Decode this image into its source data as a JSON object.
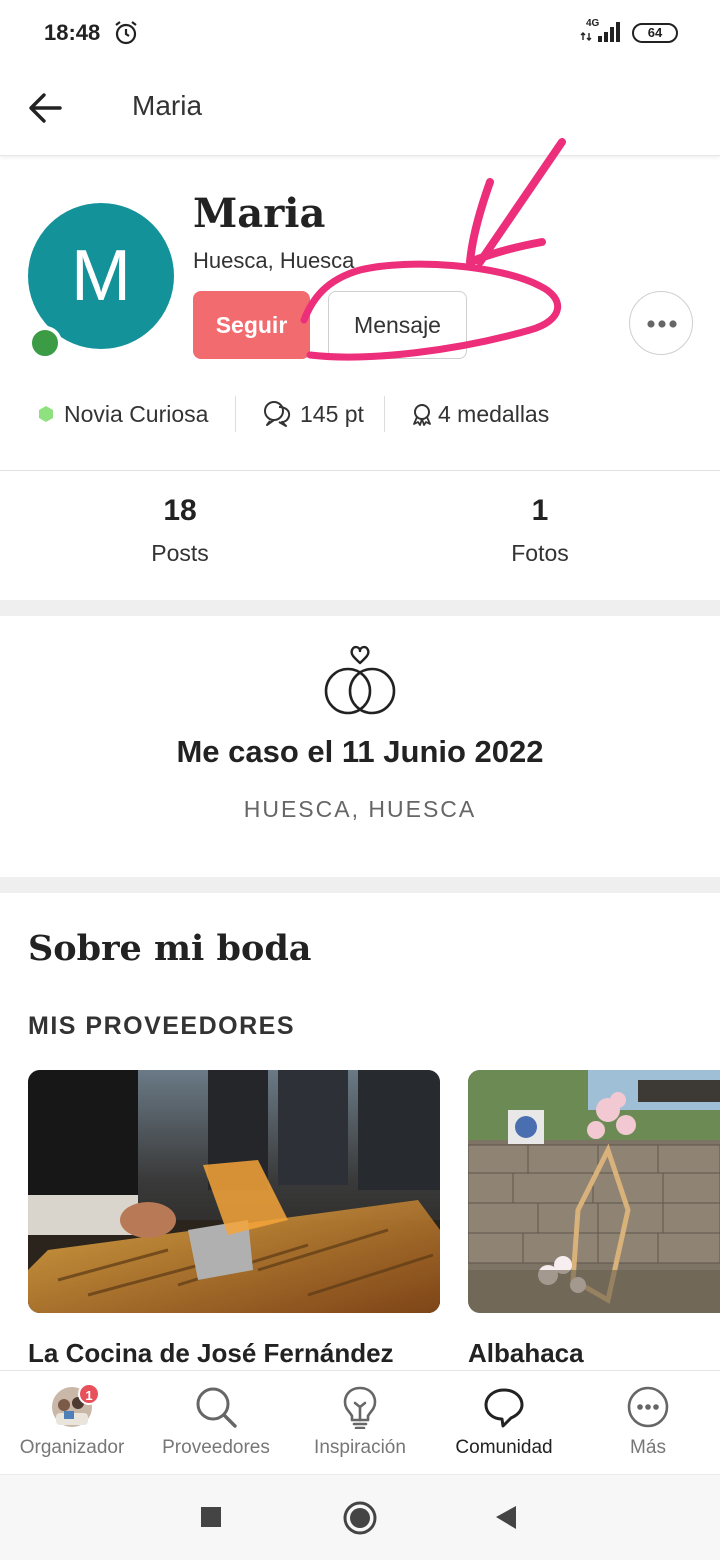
{
  "status_bar": {
    "time": "18:48",
    "network": "4G",
    "battery": "64"
  },
  "app_bar": {
    "title": "Maria"
  },
  "profile": {
    "avatar_letter": "M",
    "name": "Maria",
    "location": "Huesca, Huesca",
    "follow_label": "Seguir",
    "message_label": "Mensaje",
    "accent": "#f26b6f",
    "avatar_color": "#14929a"
  },
  "stats": {
    "level": "Novia Curiosa",
    "points": "145 pt",
    "medals": "4 medallas"
  },
  "counts": [
    {
      "value": "18",
      "label": "Posts"
    },
    {
      "value": "1",
      "label": "Fotos"
    }
  ],
  "wedding": {
    "date": "Me caso el 11 Junio 2022",
    "place": "HUESCA, HUESCA"
  },
  "about": {
    "title": "Sobre mi boda",
    "vendors_title": "MIS PROVEEDORES",
    "vendors": [
      {
        "name": "La Cocina de José Fernández"
      },
      {
        "name": "Albahaca"
      }
    ]
  },
  "bottom_nav": {
    "items": [
      {
        "label": "Organizador",
        "icon": "organizer-avatar-icon",
        "badge": "1"
      },
      {
        "label": "Proveedores",
        "icon": "search-icon"
      },
      {
        "label": "Inspiración",
        "icon": "lightbulb-icon"
      },
      {
        "label": "Comunidad",
        "icon": "chat-bubble-icon",
        "active": true
      },
      {
        "label": "Más",
        "icon": "more-icon"
      }
    ]
  }
}
